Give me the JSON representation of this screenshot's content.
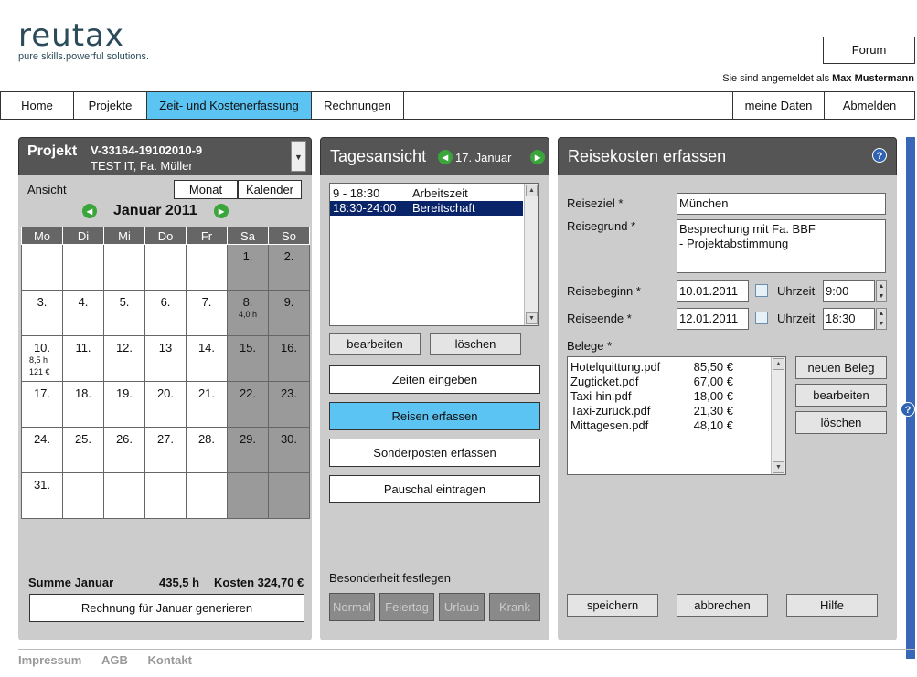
{
  "logo": {
    "word": "reutax",
    "tagline": "pure skills.powerful solutions."
  },
  "header": {
    "forum": "Forum",
    "login_prefix": "Sie sind angemeldet als",
    "user": "Max Mustermann"
  },
  "nav": {
    "home": "Home",
    "projekte": "Projekte",
    "zeit": "Zeit- und Kostenerfassung",
    "rechnungen": "Rechnungen",
    "meine_daten": "meine Daten",
    "abmelden": "Abmelden"
  },
  "project": {
    "label": "Projekt",
    "code": "V-33164-19102010-9",
    "client": "TEST IT, Fa. Müller",
    "ansicht": "Ansicht",
    "monat": "Monat",
    "kalender": "Kalender",
    "month_title": "Januar 2011",
    "weekdays": [
      "Mo",
      "Di",
      "Mi",
      "Do",
      "Fr",
      "Sa",
      "So"
    ],
    "weeks": [
      [
        {
          "d": ""
        },
        {
          "d": ""
        },
        {
          "d": ""
        },
        {
          "d": ""
        },
        {
          "d": ""
        },
        {
          "d": "1.",
          "we": true
        },
        {
          "d": "2.",
          "we": true
        }
      ],
      [
        {
          "d": "3."
        },
        {
          "d": "4."
        },
        {
          "d": "5."
        },
        {
          "d": "6."
        },
        {
          "d": "7."
        },
        {
          "d": "8.",
          "we": true,
          "sub": "4,0 h"
        },
        {
          "d": "9.",
          "we": true
        }
      ],
      [
        {
          "d": "10.",
          "sub": "8,5 h",
          "sub2": "121 €"
        },
        {
          "d": "11."
        },
        {
          "d": "12."
        },
        {
          "d": "13"
        },
        {
          "d": "14."
        },
        {
          "d": "15.",
          "we": true
        },
        {
          "d": "16.",
          "we": true
        }
      ],
      [
        {
          "d": "17."
        },
        {
          "d": "18."
        },
        {
          "d": "19."
        },
        {
          "d": "20."
        },
        {
          "d": "21."
        },
        {
          "d": "22.",
          "we": true
        },
        {
          "d": "23.",
          "we": true
        }
      ],
      [
        {
          "d": "24."
        },
        {
          "d": "25."
        },
        {
          "d": "26."
        },
        {
          "d": "27."
        },
        {
          "d": "28."
        },
        {
          "d": "29.",
          "we": true
        },
        {
          "d": "30.",
          "we": true
        }
      ],
      [
        {
          "d": "31."
        },
        {
          "d": ""
        },
        {
          "d": ""
        },
        {
          "d": ""
        },
        {
          "d": ""
        },
        {
          "d": "",
          "we": true
        },
        {
          "d": "",
          "we": true
        }
      ]
    ],
    "summe_label": "Summe Januar",
    "summe_hours": "435,5 h",
    "kosten": "Kosten 324,70 €",
    "generate": "Rechnung für Januar generieren"
  },
  "tagesansicht": {
    "title": "Tagesansicht",
    "date": "17. Januar",
    "entries": [
      {
        "time": "9 - 18:30",
        "type": "Arbeitszeit"
      },
      {
        "time": "18:30-24:00",
        "type": "Bereitschaft"
      }
    ],
    "bearbeiten": "bearbeiten",
    "loeschen": "löschen",
    "zeiten": "Zeiten eingeben",
    "reisen": "Reisen erfassen",
    "sonderposten": "Sonderposten erfassen",
    "pauschal": "Pauschal eintragen",
    "besonderheit": "Besonderheit festlegen",
    "specials": [
      "Normal",
      "Feiertag",
      "Urlaub",
      "Krank"
    ]
  },
  "reise": {
    "title": "Reisekosten erfassen",
    "help": "?",
    "ziel_label": "Reiseziel *",
    "ziel": "München",
    "grund_label": "Reisegrund *",
    "grund_line1": "Besprechung mit Fa. BBF",
    "grund_line2": "- Projektabstimmung",
    "beginn_label": "Reisebeginn *",
    "beginn_date": "10.01.2011",
    "uhrzeit": "Uhrzeit",
    "beginn_time": "9:00",
    "ende_label": "Reiseende *",
    "ende_date": "12.01.2011",
    "ende_time": "18:30",
    "belege_label": "Belege *",
    "belege": [
      {
        "file": "Hotelquittung.pdf",
        "amount": "85,50 €"
      },
      {
        "file": "Zugticket.pdf",
        "amount": "67,00 €"
      },
      {
        "file": "Taxi-hin.pdf",
        "amount": "18,00 €"
      },
      {
        "file": "Taxi-zurück.pdf",
        "amount": "21,30 €"
      },
      {
        "file": "Mittagesen.pdf",
        "amount": "48,10 €"
      }
    ],
    "neuer_beleg": "neuen Beleg",
    "bearbeiten": "bearbeiten",
    "loeschen": "löschen",
    "speichern": "speichern",
    "abbrechen": "abbrechen",
    "hilfe": "Hilfe"
  },
  "footer": {
    "impressum": "Impressum",
    "agb": "AGB",
    "kontakt": "Kontakt"
  },
  "colors": {
    "accent": "#5cc4f2",
    "panel": "#cccccc",
    "header": "#555555"
  }
}
